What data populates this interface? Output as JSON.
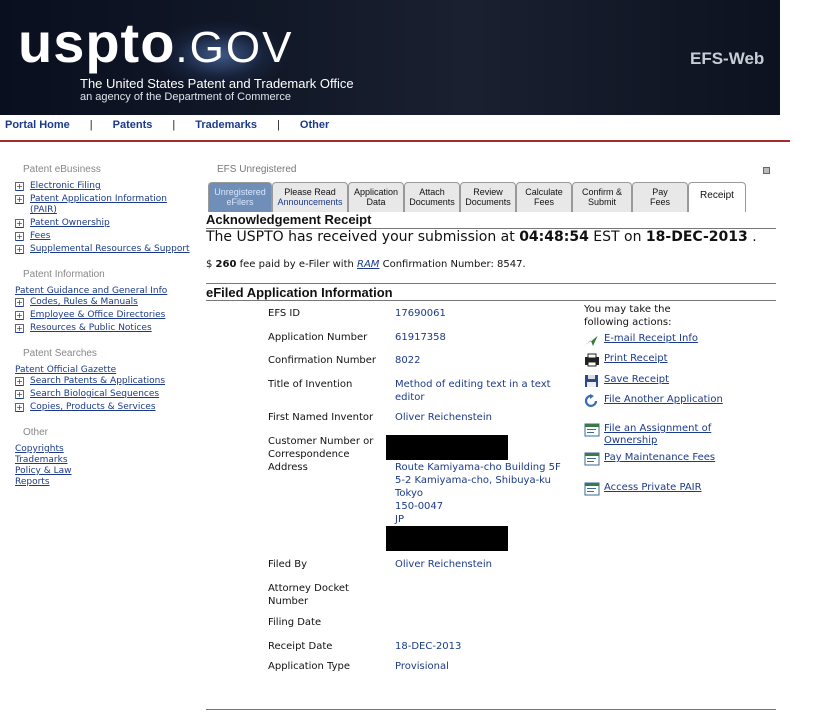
{
  "header": {
    "logo_main": "uspto",
    "logo_suffix": ".GOV",
    "tagline": "The United States Patent and Trademark Office",
    "subtagline": "an agency of the Department of Commerce",
    "efs_web": "EFS-Web"
  },
  "topnav": [
    "Portal Home",
    "Patents",
    "Trademarks",
    "Other"
  ],
  "sidebar": {
    "patent_ebusiness": {
      "heading": "Patent eBusiness",
      "items": [
        "Electronic Filing",
        "Patent Application Information (PAIR)",
        "Patent Ownership",
        "Fees",
        "Supplemental Resources & Support"
      ]
    },
    "patent_information": {
      "heading": "Patent Information",
      "link": "Patent Guidance and General Info",
      "items": [
        "Codes, Rules & Manuals",
        "Employee & Office Directories",
        "Resources & Public Notices"
      ]
    },
    "patent_searches": {
      "heading": "Patent Searches",
      "link": "Patent Official Gazette",
      "items": [
        "Search Patents & Applications",
        "Search Biological Sequences",
        "Copies, Products & Services"
      ]
    },
    "other": {
      "heading": "Other",
      "links": [
        "Copyrights",
        "Trademarks",
        "Policy & Law",
        "Reports"
      ]
    }
  },
  "main": {
    "status": "EFS Unregistered",
    "tabs": [
      {
        "l1": "Unregistered",
        "l2": "eFilers"
      },
      {
        "l1": "Please Read",
        "l2": "Announcements"
      },
      {
        "l1": "Application",
        "l2": "Data"
      },
      {
        "l1": "Attach",
        "l2": "Documents"
      },
      {
        "l1": "Review",
        "l2": "Documents"
      },
      {
        "l1": "Calculate",
        "l2": "Fees"
      },
      {
        "l1": "Confirm &",
        "l2": "Submit"
      },
      {
        "l1": "Pay",
        "l2": "Fees"
      },
      {
        "l1": "Receipt",
        "l2": ""
      }
    ],
    "ack_title": "Acknowledgement Receipt",
    "ack_prefix": "The USPTO has received your submission at ",
    "ack_time": "04:48:54",
    "ack_mid": " EST on ",
    "ack_date": "18-DEC-2013",
    "ack_suffix": " .",
    "fee_prefix": "$ ",
    "fee_amount": "260",
    "fee_mid": " fee paid by e-Filer with ",
    "fee_ram": "RAM",
    "fee_suffix": " Confirmation Number: 8547.",
    "efiled_title": "eFiled Application Information",
    "fields": {
      "efs_id_label": "EFS ID",
      "efs_id": "17690061",
      "app_num_label": "Application Number",
      "app_num": "61917358",
      "conf_label": "Confirmation Number",
      "conf": "8022",
      "title_label": "Title of Invention",
      "title": "Method of editing text in a text editor",
      "inventor_label": "First Named Inventor",
      "inventor": "Oliver Reichenstein",
      "customer_label": "Customer Number or Correspondence Address",
      "address_lines": [
        "Route Kamiyama-cho Building 5F",
        "5-2 Kamiyama-cho, Shibuya-ku",
        "Tokyo",
        "150-0047",
        "JP"
      ],
      "filed_by_label": "Filed By",
      "filed_by": "Oliver Reichenstein",
      "docket_label": "Attorney Docket Number",
      "filing_date_label": "Filing Date",
      "receipt_date_label": "Receipt Date",
      "receipt_date": "18-DEC-2013",
      "app_type_label": "Application Type",
      "app_type": "Provisional"
    },
    "actions_head": "You may take the following actions:",
    "actions": [
      "E-mail Receipt Info",
      "Print Receipt",
      "Save Receipt",
      "File Another Application",
      "File an Assignment of Ownership",
      "Pay Maintenance Fees",
      "Access Private PAIR"
    ]
  }
}
